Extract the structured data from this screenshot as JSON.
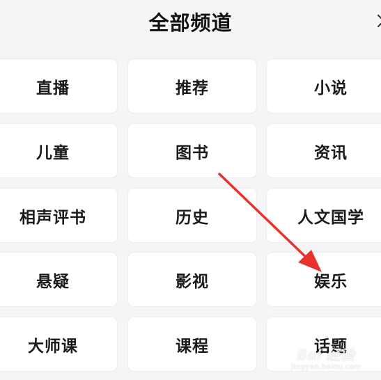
{
  "header": {
    "title": "全部频道"
  },
  "channels": [
    "直播",
    "推荐",
    "小说",
    "儿童",
    "图书",
    "资讯",
    "相声评书",
    "历史",
    "人文国学",
    "悬疑",
    "影视",
    "娱乐",
    "大师课",
    "课程",
    "话题"
  ],
  "icons": {
    "close": "close-icon"
  },
  "colors": {
    "background": "#f5f5f7",
    "tile": "#ffffff",
    "text": "#1b1b1b",
    "arrow": "#e8322b"
  },
  "watermark": {
    "main": "Bai 经验",
    "sub": "jingyan.baidu.com"
  }
}
